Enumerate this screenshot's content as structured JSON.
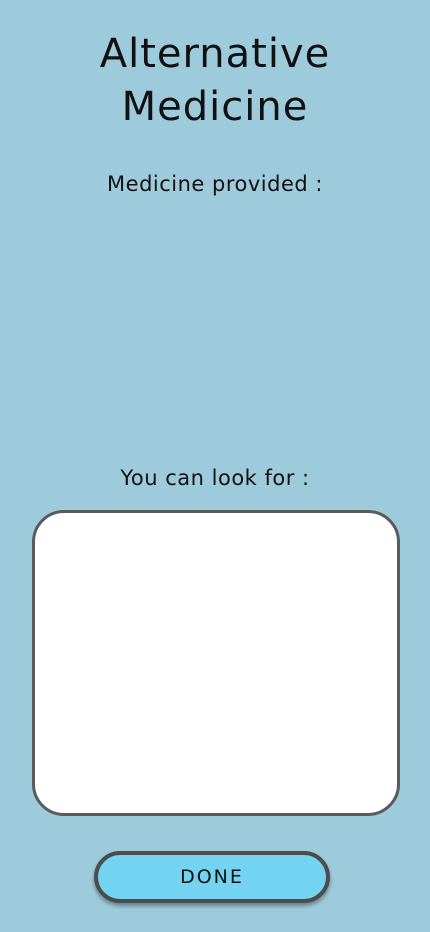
{
  "page": {
    "title": "Alternative\nMedicine"
  },
  "sections": {
    "provided_label": "Medicine provided :",
    "lookfor_label": "You can look for :"
  },
  "actions": {
    "done_label": "DONE"
  },
  "colors": {
    "background": "#9ecbdc",
    "button_fill": "#74d3f0",
    "box_fill": "#ffffff",
    "border": "#5b5b5b"
  }
}
